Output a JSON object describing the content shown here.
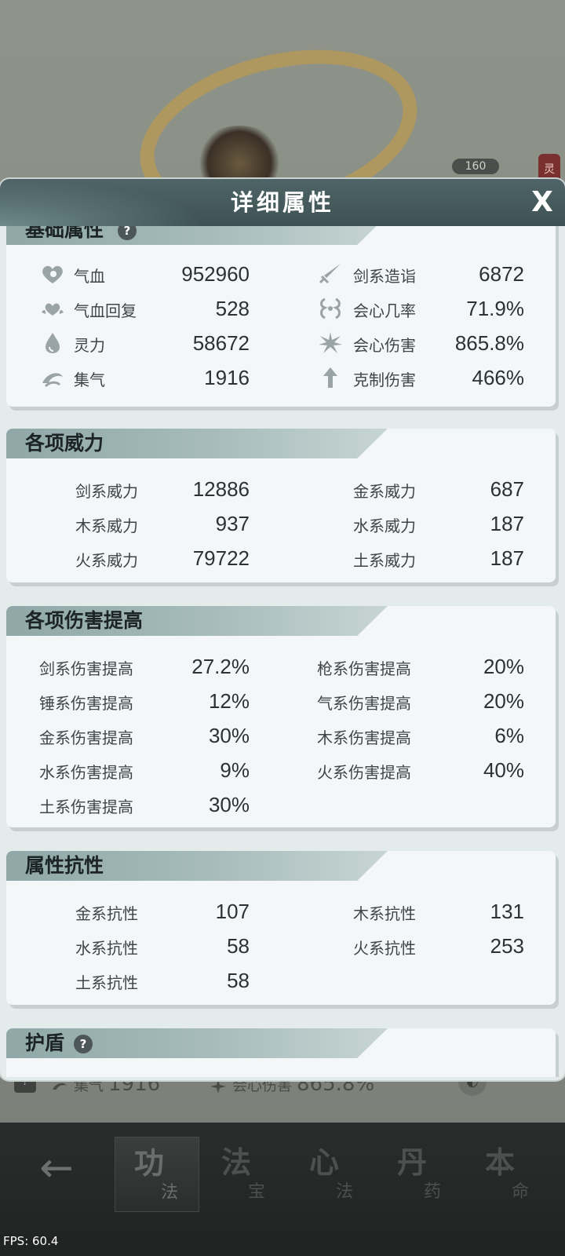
{
  "background": {
    "level": "160",
    "corner_tag": "灵",
    "peek": {
      "jiqi_label": "集气",
      "jiqi_value": "1916",
      "crit_label": "会心伤害",
      "crit_value": "865.8%"
    }
  },
  "modal": {
    "title": "详细属性",
    "close_label": "X"
  },
  "basic": {
    "title": "基础属性",
    "help": "?",
    "left": [
      {
        "icon": "heart-icon",
        "label": "气血",
        "value": "952960"
      },
      {
        "icon": "heart-regen-icon",
        "label": "气血回复",
        "value": "528"
      },
      {
        "icon": "drop-icon",
        "label": "灵力",
        "value": "58672"
      },
      {
        "icon": "swirl-icon",
        "label": "集气",
        "value": "1916"
      }
    ],
    "right": [
      {
        "icon": "sword-icon",
        "label": "剑系造诣",
        "value": "6872"
      },
      {
        "icon": "crit-rate-icon",
        "label": "会心几率",
        "value": "71.9%"
      },
      {
        "icon": "burst-icon",
        "label": "会心伤害",
        "value": "865.8%"
      },
      {
        "icon": "arrow-up-icon",
        "label": "克制伤害",
        "value": "466%"
      }
    ]
  },
  "power": {
    "title": "各项威力",
    "left": [
      {
        "label": "剑系威力",
        "value": "12886"
      },
      {
        "label": "木系威力",
        "value": "937"
      },
      {
        "label": "火系威力",
        "value": "79722"
      }
    ],
    "right": [
      {
        "label": "金系威力",
        "value": "687"
      },
      {
        "label": "水系威力",
        "value": "187"
      },
      {
        "label": "土系威力",
        "value": "187"
      }
    ]
  },
  "damage": {
    "title": "各项伤害提高",
    "left": [
      {
        "label": "剑系伤害提高",
        "value": "27.2%"
      },
      {
        "label": "锤系伤害提高",
        "value": "12%"
      },
      {
        "label": "金系伤害提高",
        "value": "30%"
      },
      {
        "label": "水系伤害提高",
        "value": "9%"
      },
      {
        "label": "土系伤害提高",
        "value": "30%"
      }
    ],
    "right": [
      {
        "label": "枪系伤害提高",
        "value": "20%"
      },
      {
        "label": "气系伤害提高",
        "value": "20%"
      },
      {
        "label": "木系伤害提高",
        "value": "6%"
      },
      {
        "label": "火系伤害提高",
        "value": "40%"
      }
    ]
  },
  "resist": {
    "title": "属性抗性",
    "left": [
      {
        "label": "金系抗性",
        "value": "107"
      },
      {
        "label": "水系抗性",
        "value": "58"
      },
      {
        "label": "土系抗性",
        "value": "58"
      }
    ],
    "right": [
      {
        "label": "木系抗性",
        "value": "131"
      },
      {
        "label": "火系抗性",
        "value": "253"
      }
    ]
  },
  "shield": {
    "title": "护盾",
    "help": "?"
  },
  "nav": {
    "back": "←",
    "tabs": [
      {
        "big": "功",
        "small": "法"
      },
      {
        "big": "法",
        "small": "宝"
      },
      {
        "big": "心",
        "small": "法"
      },
      {
        "big": "丹",
        "small": "药"
      },
      {
        "big": "本",
        "small": "命"
      }
    ]
  },
  "fps": "FPS: 60.4"
}
